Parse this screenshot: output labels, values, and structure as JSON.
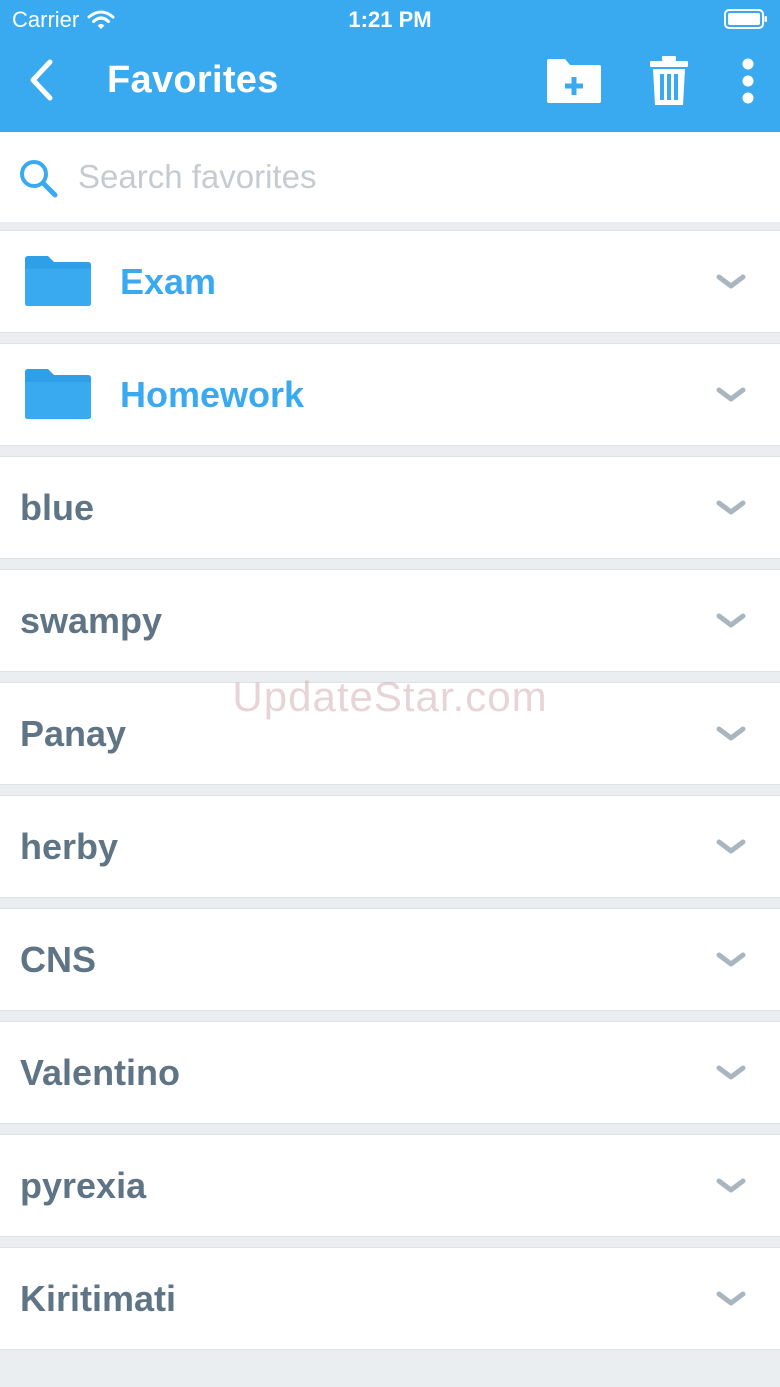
{
  "status_bar": {
    "carrier": "Carrier",
    "time": "1:21 PM"
  },
  "nav": {
    "title": "Favorites",
    "icons": {
      "back": "chevron-left-icon",
      "new_folder": "folder-add-icon",
      "delete": "trash-icon",
      "more": "more-vertical-icon"
    }
  },
  "search": {
    "placeholder": "Search favorites",
    "icon": "search-icon"
  },
  "favorites": {
    "folders": [
      {
        "label": "Exam",
        "icon": "folder-icon"
      },
      {
        "label": "Homework",
        "icon": "folder-icon"
      }
    ],
    "items": [
      {
        "label": "blue"
      },
      {
        "label": "swampy"
      },
      {
        "label": "Panay"
      },
      {
        "label": "herby"
      },
      {
        "label": "CNS"
      },
      {
        "label": "Valentino"
      },
      {
        "label": "pyrexia"
      },
      {
        "label": "Kiritimati"
      }
    ]
  },
  "watermark": "UpdateStar.com",
  "colors": {
    "accent": "#3aaaf0",
    "item_text": "#5f7585",
    "chevron": "#a9b6c0",
    "background": "#ebeef0"
  }
}
